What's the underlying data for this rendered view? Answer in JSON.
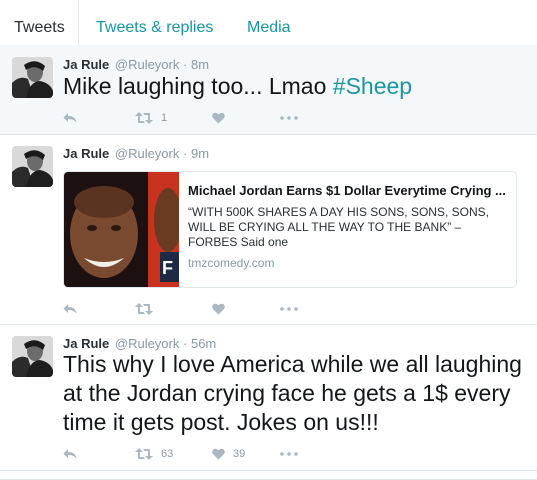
{
  "tabs": [
    {
      "label": "Tweets"
    },
    {
      "label": "Tweets & replies"
    },
    {
      "label": "Media"
    }
  ],
  "tweets": [
    {
      "name": "Ja Rule",
      "handle": "@Ruleyork",
      "separator": "·",
      "time": "8m",
      "text": "Mike laughing too... Lmao ",
      "hashtag": "#Sheep",
      "retweets": "1",
      "likes": ""
    },
    {
      "name": "Ja Rule",
      "handle": "@Ruleyork",
      "separator": "·",
      "time": "9m",
      "card": {
        "title": "Michael Jordan Earns $1 Dollar Everytime Crying ...",
        "description": "“WITH 500K SHARES A DAY HIS SONS, SONS, SONS, WILL BE CRYING ALL THE WAY TO THE BANK” – FORBES Said one",
        "domain": "tmzcomedy.com"
      },
      "retweets": "",
      "likes": ""
    },
    {
      "name": "Ja Rule",
      "handle": "@Ruleyork",
      "separator": "·",
      "time": "56m",
      "text": "This why I love America while we all laughing at the Jordan crying face he gets a 1$ every time it gets post. Jokes on us!!!",
      "retweets": "63",
      "likes": "39"
    }
  ],
  "colors": {
    "link": "#1b95a0",
    "muted": "#8899a6",
    "border": "#e1e8ed",
    "highlight_bg": "#f5f8fa"
  },
  "icons": [
    "reply-icon",
    "retweet-icon",
    "like-icon",
    "more-icon"
  ]
}
